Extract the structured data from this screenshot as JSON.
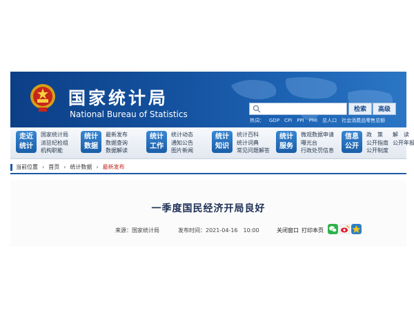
{
  "header": {
    "title_cn": "国家统计局",
    "title_en": "National Bureau of Statistics",
    "search_button": "检索",
    "advanced_button": "高级",
    "hot_label": "热词：",
    "hot_words": [
      "GDP",
      "CPI",
      "PPI",
      "PMI",
      "总人口",
      "社会消费品零售总额"
    ]
  },
  "nav": [
    {
      "badge": [
        "走近",
        "统计"
      ],
      "links": [
        "国家统计局",
        "派驻纪检组",
        "机构职能"
      ]
    },
    {
      "badge": [
        "统计",
        "数据"
      ],
      "links": [
        "最新发布",
        "数据查询",
        "数据解读"
      ]
    },
    {
      "badge": [
        "统计",
        "工作"
      ],
      "links": [
        "统计动态",
        "通知公告",
        "图片新闻"
      ]
    },
    {
      "badge": [
        "统计",
        "知识"
      ],
      "links": [
        "统计百科",
        "统计词典",
        "常见问题解答"
      ]
    },
    {
      "badge": [
        "统计",
        "服务"
      ],
      "links": [
        "微观数据申请",
        "曝光台",
        "行政处罚信息"
      ]
    },
    {
      "badge": [
        "信息",
        "公开"
      ],
      "links": [
        "政　策",
        "公开指南",
        "公开制度"
      ],
      "links2": [
        "解　读",
        "公开年报",
        ""
      ]
    }
  ],
  "breadcrumb": {
    "items": [
      "当前位置",
      "首页",
      "统计数据",
      "最新发布"
    ],
    "separator": "›"
  },
  "article": {
    "title": "一季度国民经济开局良好",
    "source_label": "来源：",
    "source": "国家统计局",
    "time_label": "发布时间：",
    "time": "2021-04-16　10:00",
    "close_window": "关闭窗口",
    "print_page": "打印本页"
  },
  "colors": {
    "banner": "#14519e",
    "accent": "#1d5aa6",
    "current_crumb": "#c0281f",
    "title": "#1e2f55"
  }
}
